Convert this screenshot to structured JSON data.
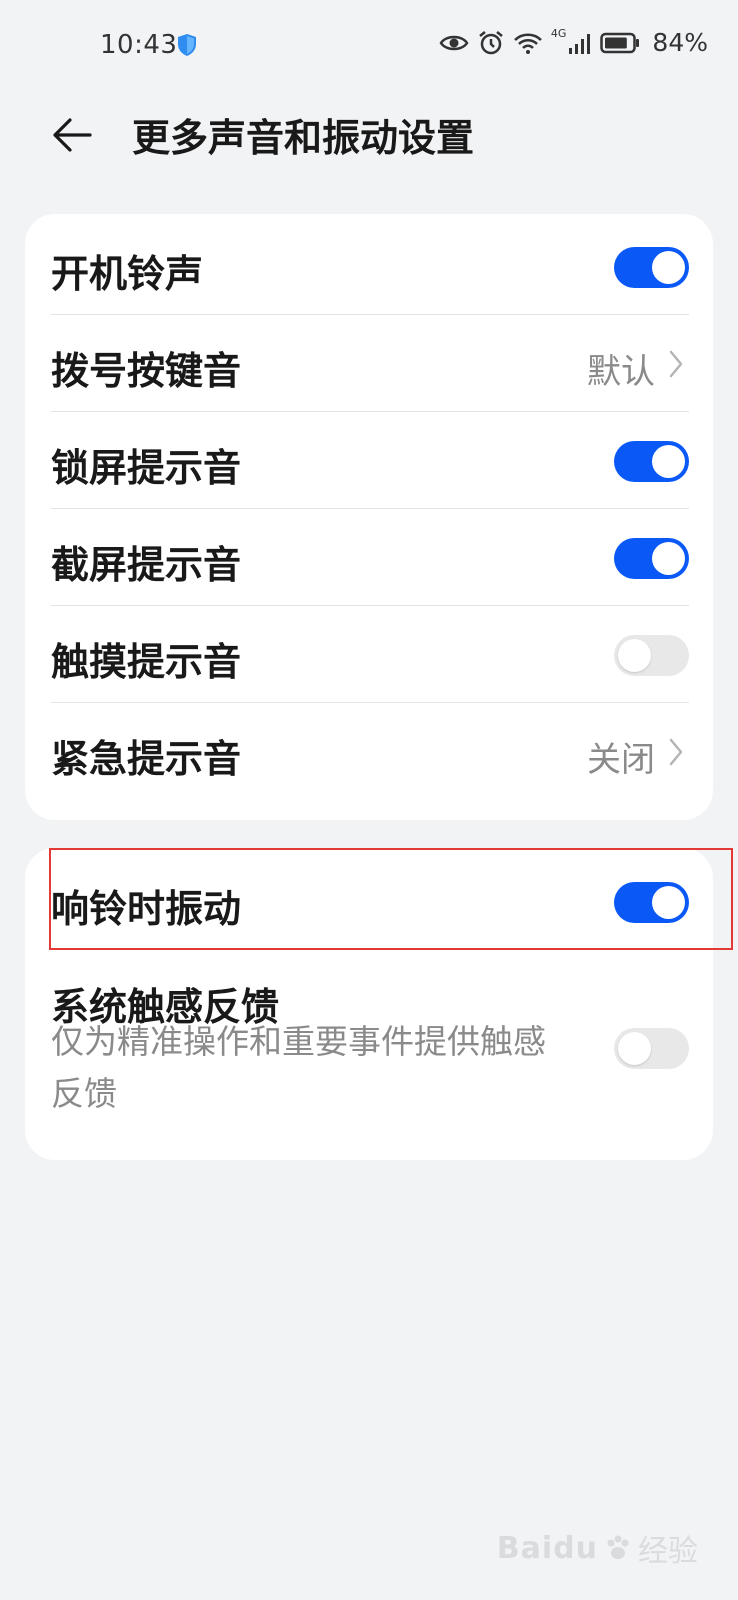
{
  "status_bar": {
    "time": "10:43",
    "network": "4G",
    "battery_percent": "84%",
    "battery_level": 0.84
  },
  "header": {
    "title": "更多声音和振动设置"
  },
  "group1": [
    {
      "label": "开机铃声",
      "type": "toggle",
      "on": true
    },
    {
      "label": "拨号按键音",
      "type": "value",
      "value": "默认"
    },
    {
      "label": "锁屏提示音",
      "type": "toggle",
      "on": true
    },
    {
      "label": "截屏提示音",
      "type": "toggle",
      "on": true
    },
    {
      "label": "触摸提示音",
      "type": "toggle",
      "on": false
    },
    {
      "label": "紧急提示音",
      "type": "value",
      "value": "关闭"
    }
  ],
  "group2": {
    "vibrate_on_ring": {
      "label": "响铃时振动",
      "on": true
    },
    "haptic": {
      "label": "系统触感反馈",
      "description": "仅为精准操作和重要事件提供触感反馈",
      "on": false
    }
  },
  "colors": {
    "accent": "#0a59f7",
    "highlight": "#e53935"
  },
  "watermark": {
    "brand": "Baidu",
    "sub": "经验"
  }
}
